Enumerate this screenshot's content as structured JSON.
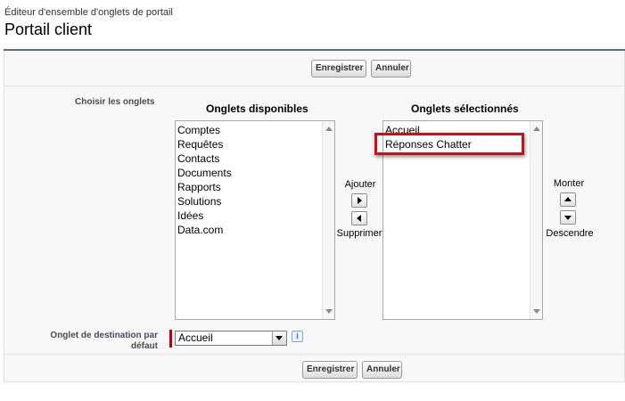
{
  "header": {
    "subtitle": "Éditeur d'ensemble d'onglets de portail",
    "title": "Portail client"
  },
  "buttons": {
    "save": "Enregistrer",
    "cancel": "Annuler"
  },
  "form": {
    "choose_tabs_label": "Choisir les onglets",
    "available_heading": "Onglets disponibles",
    "selected_heading": "Onglets sélectionnés",
    "available_tabs": [
      "Comptes",
      "Requêtes",
      "Contacts",
      "Documents",
      "Rapports",
      "Solutions",
      "Idées",
      "Data.com"
    ],
    "selected_tabs": [
      "Accueil",
      "Réponses Chatter"
    ],
    "add_label": "Ajouter",
    "remove_label": "Supprimer",
    "up_label": "Monter",
    "down_label": "Descendre",
    "default_tab_label_line1": "Onglet de destination par",
    "default_tab_label_line2": "défaut",
    "default_tab_value": "Accueil",
    "info_icon_glyph": "i"
  },
  "colors": {
    "header_rule": "#5a6e85",
    "required": "#c00000",
    "highlight": "#c8101a"
  }
}
